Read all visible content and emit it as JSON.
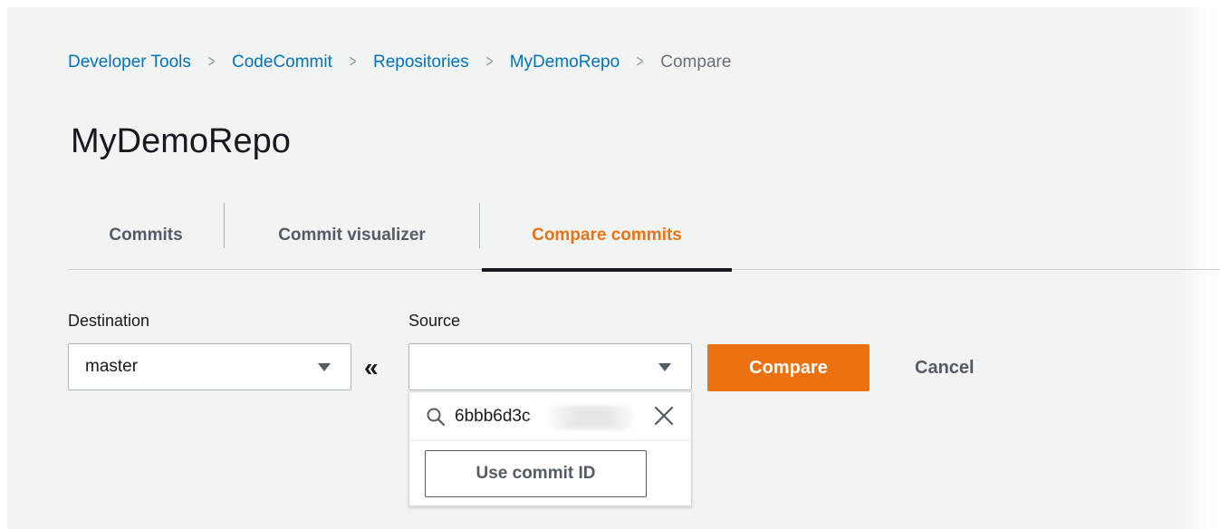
{
  "breadcrumb": {
    "items": [
      "Developer Tools",
      "CodeCommit",
      "Repositories",
      "MyDemoRepo"
    ],
    "current": "Compare"
  },
  "page": {
    "title": "MyDemoRepo"
  },
  "tabs": [
    {
      "label": "Commits",
      "active": false
    },
    {
      "label": "Commit visualizer",
      "active": false
    },
    {
      "label": "Compare commits",
      "active": true
    }
  ],
  "form": {
    "destination": {
      "label": "Destination",
      "value": "master"
    },
    "source": {
      "label": "Source",
      "value": ""
    },
    "swap_icon": "double-chevron-left-icon",
    "compare_label": "Compare",
    "cancel_label": "Cancel"
  },
  "source_dropdown": {
    "search_value": "6bbb6d3c",
    "search_icon": "search-icon",
    "clear_icon": "close-icon",
    "use_commit_label": "Use commit ID"
  },
  "colors": {
    "accent": "#ec7211",
    "link": "#0073bb",
    "background": "#f2f3f3"
  }
}
